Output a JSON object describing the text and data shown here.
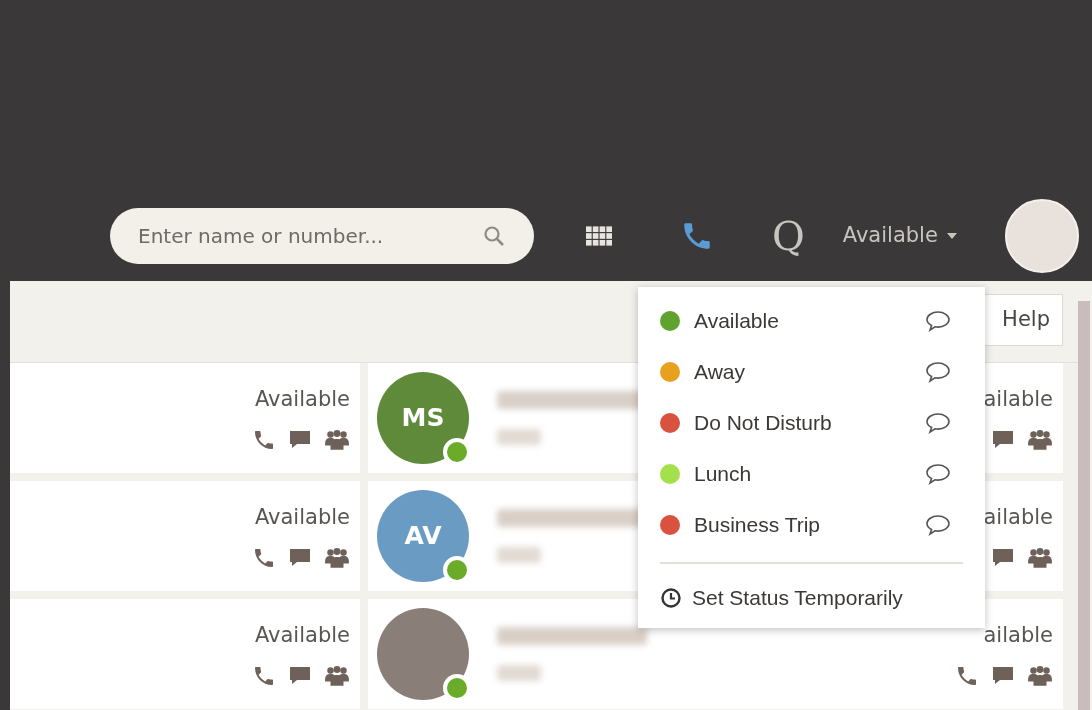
{
  "header": {
    "search": {
      "placeholder": "Enter name or number..."
    },
    "q_label": "Q",
    "status": {
      "label": "Available"
    }
  },
  "toolbar": {
    "help_button": "Help"
  },
  "contacts": [
    {
      "status_text": "Available",
      "avatar": {
        "kind": "initials",
        "initials": "MS",
        "color": "#5f8a3a"
      },
      "status_text_right": "ailable",
      "right_actions": [
        {
          "kind": "chat"
        },
        {
          "kind": "group"
        }
      ]
    },
    {
      "status_text": "Available",
      "avatar": {
        "kind": "initials",
        "initials": "AV",
        "color": "#6a9bc3"
      },
      "status_text_right": "ailable",
      "right_actions": [
        {
          "kind": "chat"
        },
        {
          "kind": "group"
        }
      ]
    },
    {
      "status_text": "Available",
      "avatar": {
        "kind": "photo"
      },
      "status_text_right": "ailable",
      "right_actions": [
        {
          "kind": "phone"
        },
        {
          "kind": "chat"
        },
        {
          "kind": "group"
        }
      ]
    }
  ],
  "status_menu": {
    "items": [
      {
        "label": "Available",
        "color": "#5fa32e"
      },
      {
        "label": "Away",
        "color": "#e8a01f"
      },
      {
        "label": "Do Not Disturb",
        "color": "#d9523f"
      },
      {
        "label": "Lunch",
        "color": "#a3e04c"
      },
      {
        "label": "Business Trip",
        "color": "#d9523f"
      }
    ],
    "temporary": "Set Status Temporarily"
  }
}
